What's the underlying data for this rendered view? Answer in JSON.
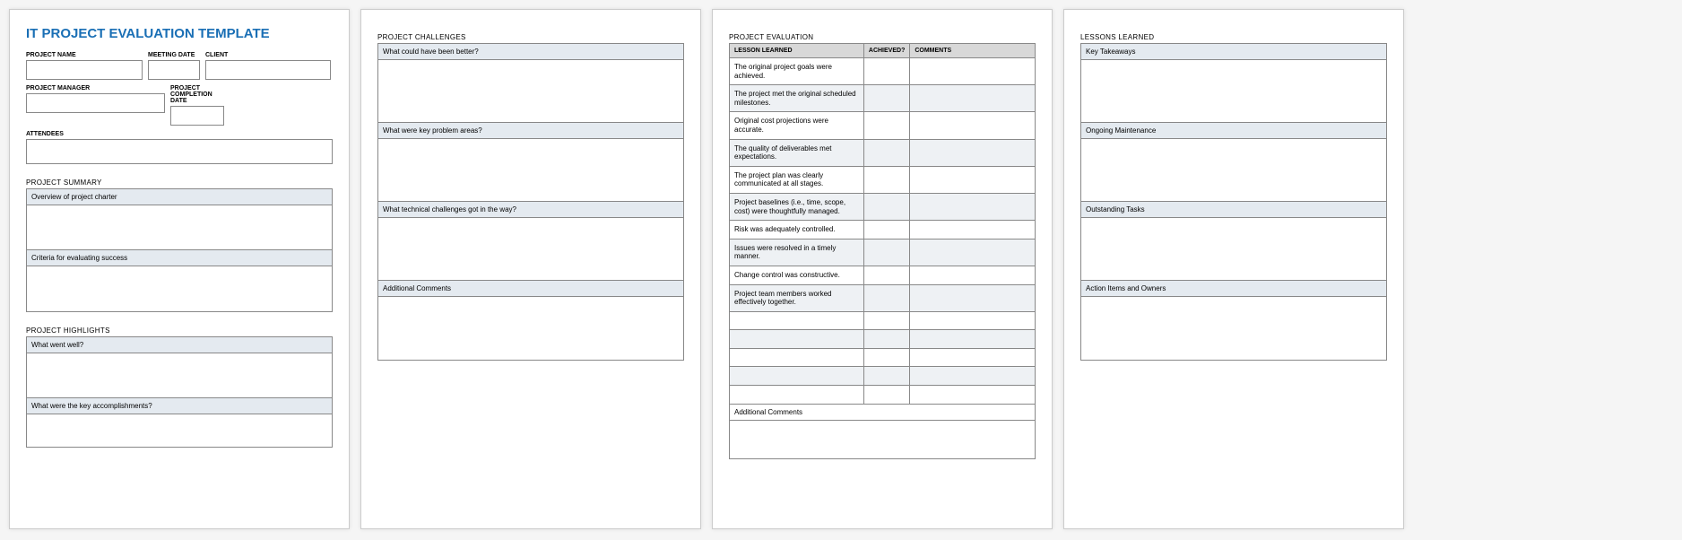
{
  "title": "IT PROJECT EVALUATION TEMPLATE",
  "fields": {
    "project_name": "PROJECT NAME",
    "meeting_date": "MEETING DATE",
    "client": "CLIENT",
    "project_manager": "PROJECT MANAGER",
    "project_completion_date": "PROJECT COMPLETION DATE",
    "attendees": "ATTENDEES"
  },
  "sections": {
    "project_summary": {
      "title": "PROJECT SUMMARY",
      "rows": [
        {
          "label": "Overview of project charter"
        },
        {
          "label": "Criteria for evaluating success"
        }
      ]
    },
    "project_highlights": {
      "title": "PROJECT HIGHLIGHTS",
      "rows": [
        {
          "label": "What went well?"
        },
        {
          "label": "What were the key accomplishments?"
        }
      ]
    },
    "project_challenges": {
      "title": "PROJECT CHALLENGES",
      "rows": [
        {
          "label": "What could have been better?"
        },
        {
          "label": "What were key problem areas?"
        },
        {
          "label": "What technical challenges got in the way?"
        },
        {
          "label": "Additional Comments"
        }
      ]
    },
    "project_evaluation": {
      "title": "PROJECT EVALUATION",
      "headers": {
        "lesson": "LESSON LEARNED",
        "achieved": "ACHIEVED?",
        "comments": "COMMENTS"
      },
      "rows": [
        "The original project goals were achieved.",
        "The project met the original scheduled milestones.",
        "Original cost projections were accurate.",
        "The quality of deliverables met expectations.",
        "The project plan was clearly communicated at all stages.",
        "Project baselines (i.e., time, scope, cost) were thoughtfully managed.",
        "Risk was adequately controlled.",
        "Issues were resolved in a timely manner.",
        "Change control was constructive.",
        "Project team members worked effectively together.",
        "",
        "",
        "",
        "",
        ""
      ],
      "additional_comments": "Additional Comments"
    },
    "lessons_learned": {
      "title": "LESSONS LEARNED",
      "rows": [
        {
          "label": "Key Takeaways"
        },
        {
          "label": "Ongoing Maintenance"
        },
        {
          "label": "Outstanding Tasks"
        },
        {
          "label": "Action Items and Owners"
        }
      ]
    }
  }
}
